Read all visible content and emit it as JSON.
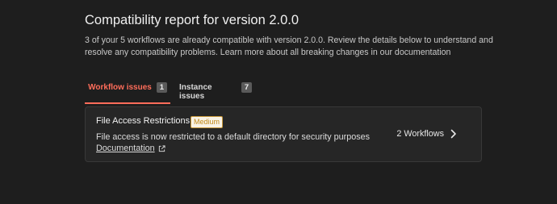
{
  "report": {
    "title": "Compatibility report for version 2.0.0",
    "intro": "3 of your 5 workflows are already compatible with version 2.0.0. Review the details below to understand and resolve any compatibility problems. Learn more about all breaking changes in our documentation"
  },
  "tabs": [
    {
      "label": "Workflow issues",
      "count": "1",
      "active": true
    },
    {
      "label": "Instance issues",
      "count": "7",
      "active": false
    }
  ],
  "issue": {
    "title": "File Access Restrictions",
    "severity": "Medium",
    "description": "File access is now restricted to a default directory for security purposes",
    "doc_link": "Documentation",
    "workflows_link": "2 Workflows"
  },
  "colors": {
    "background": "#1e1e1e",
    "accent": "#ff6d5a",
    "card_bg": "#262626",
    "badge_text": "#c28a1a"
  },
  "icons": {
    "doc_link": "external-link-icon",
    "workflows_link": "chevron-right-icon"
  }
}
